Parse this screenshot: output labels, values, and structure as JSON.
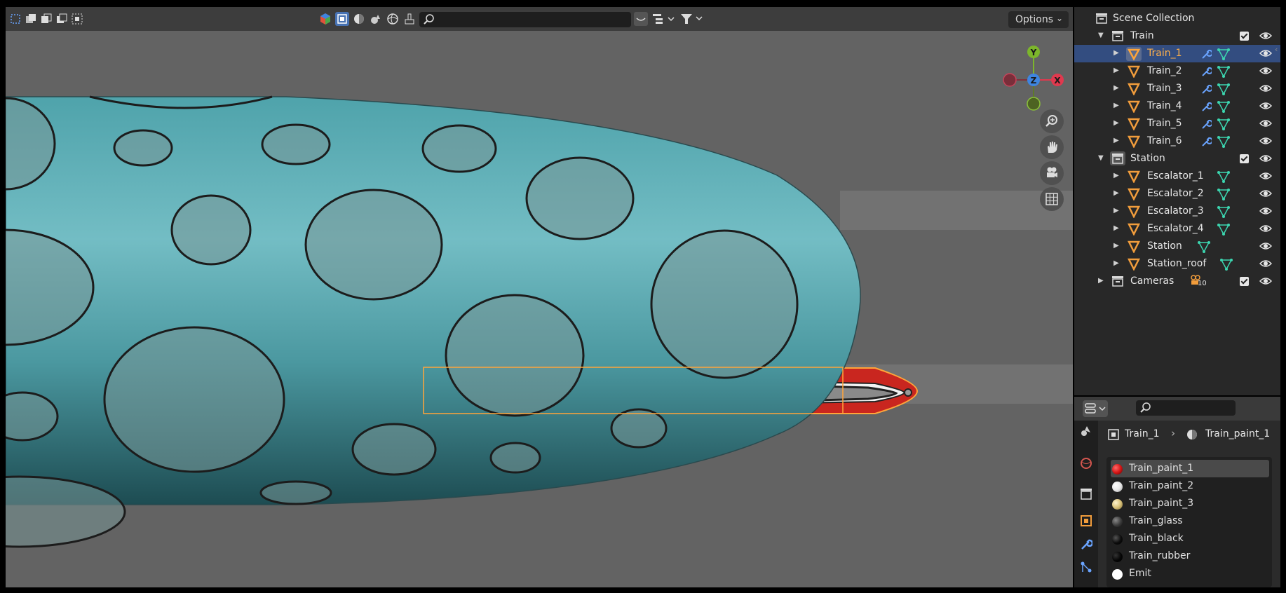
{
  "viewport": {
    "header": {
      "options_label": "Options",
      "icons": [
        "select-box-icon",
        "select-new-icon",
        "select-extend-icon",
        "select-subtract-icon",
        "select-intersect-icon",
        "view-object-types-icon",
        "solid-shading-icon",
        "material-shading-icon",
        "rendered-shading-icon",
        "wireframe-icon",
        "vertex-paint-icon",
        "search-icon",
        "filter-icon"
      ]
    },
    "gizmo": {
      "x_label": "X",
      "y_label": "Y",
      "z_label": "Z"
    }
  },
  "outliner": {
    "root_label": "Scene Collection",
    "collections": [
      {
        "name": "Train",
        "objects": [
          {
            "name": "Train_1",
            "selected": true
          },
          {
            "name": "Train_2"
          },
          {
            "name": "Train_3"
          },
          {
            "name": "Train_4"
          },
          {
            "name": "Train_5"
          },
          {
            "name": "Train_6"
          }
        ]
      },
      {
        "name": "Station",
        "objects": [
          {
            "name": "Escalator_1"
          },
          {
            "name": "Escalator_2"
          },
          {
            "name": "Escalator_3"
          },
          {
            "name": "Escalator_4"
          },
          {
            "name": "Station"
          },
          {
            "name": "Station_roof"
          }
        ]
      },
      {
        "name": "Cameras",
        "camera_count": "10"
      }
    ]
  },
  "properties": {
    "breadcrumb": {
      "object": "Train_1",
      "material": "Train_paint_1"
    },
    "materials": [
      {
        "name": "Train_paint_1",
        "color": "#d81818",
        "selected": true
      },
      {
        "name": "Train_paint_2",
        "color": "#e8e8e8"
      },
      {
        "name": "Train_paint_3",
        "color": "#d9c27a"
      },
      {
        "name": "Train_glass",
        "color": "#3a3a3a"
      },
      {
        "name": "Train_black",
        "color": "#0c0c0c"
      },
      {
        "name": "Train_rubber",
        "color": "#050505"
      },
      {
        "name": "Emit",
        "color": "#ffffff"
      }
    ]
  },
  "colors": {
    "selection": "#334d80",
    "active_object": "#ffa53a",
    "train_body": "#4fa6ae",
    "axis_x": "#e0394e",
    "axis_y": "#7cb62b",
    "axis_z": "#3e85e0"
  }
}
